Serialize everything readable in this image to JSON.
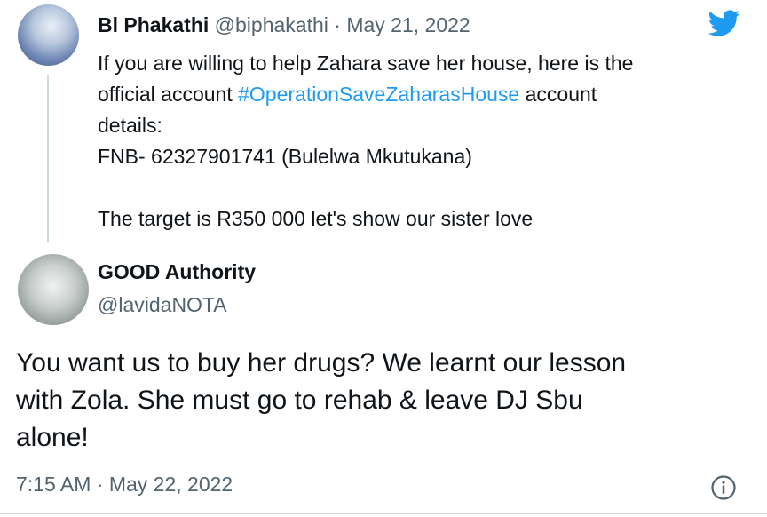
{
  "parent_tweet": {
    "display_name": "Bl Phakathi",
    "handle": "@biphakathi",
    "separator": "·",
    "date": "May 21, 2022",
    "body": {
      "line1": "If you are willing to help Zahara save her house, here is the",
      "line2_before": "official account ",
      "hashtag": "#OperationSaveZaharasHouse",
      "line2_after": " account",
      "line3": "details:",
      "line4": "FNB- 62327901741 (Bulelwa Mkutukana)",
      "line5": "The target is R350 000 let's show our sister love"
    }
  },
  "reply_tweet": {
    "display_name": "GOOD Authority",
    "handle": "@lavidaNOTA",
    "text": {
      "line1": "You want us to buy her drugs? We learnt our lesson",
      "line2": "with Zola. She must go to rehab & leave DJ Sbu",
      "line3": "alone!"
    },
    "time": "7:15 AM",
    "separator": "·",
    "date": "May 22, 2022"
  },
  "icons": {
    "logo": "twitter-bird-icon",
    "info": "info-icon",
    "brand_color": "#1d9bf0",
    "muted_color": "#536471"
  }
}
